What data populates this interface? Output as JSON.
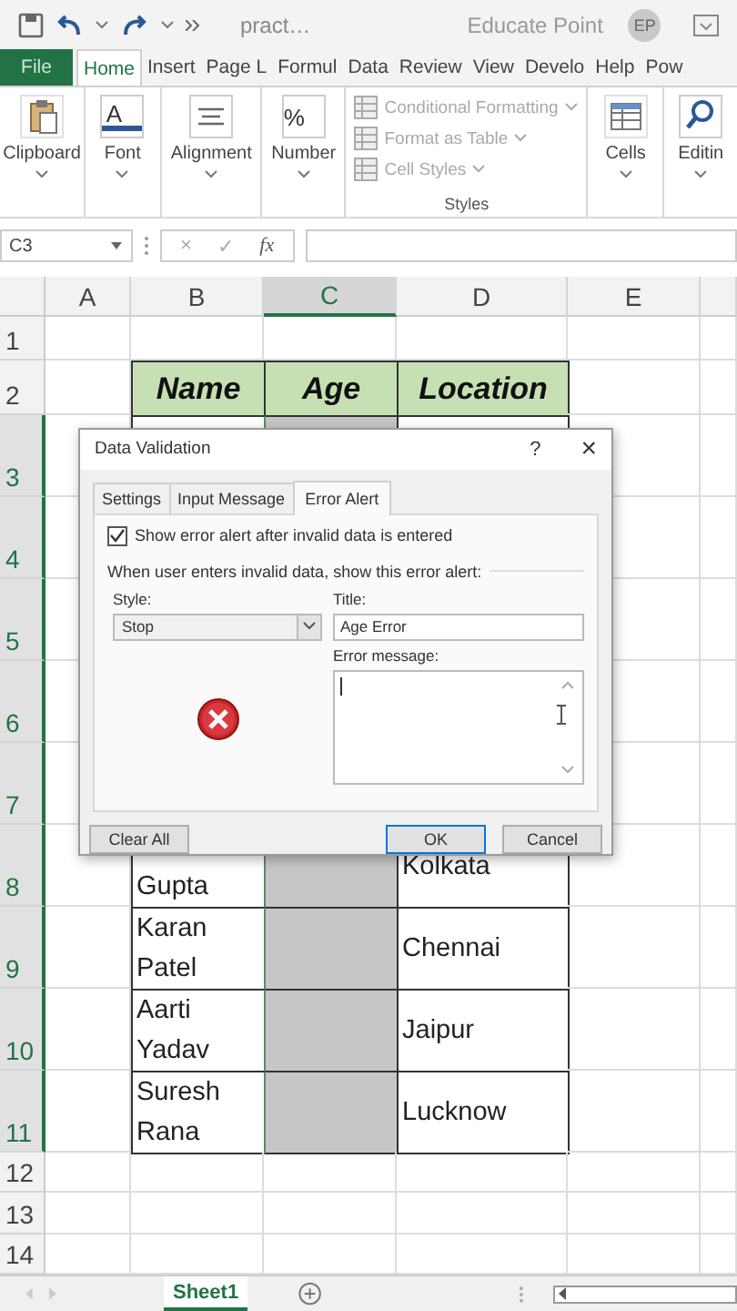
{
  "title_bar": {
    "document": "pract…",
    "account": "Educate Point",
    "initials": "EP"
  },
  "ribbon_tabs": [
    {
      "label": "File",
      "kind": "file",
      "selected": false
    },
    {
      "label": "Home",
      "kind": "tab",
      "selected": true
    },
    {
      "label": "Insert",
      "kind": "tab",
      "selected": false
    },
    {
      "label": "Page L",
      "kind": "tab",
      "selected": false
    },
    {
      "label": "Formul",
      "kind": "tab",
      "selected": false
    },
    {
      "label": "Data",
      "kind": "tab",
      "selected": false
    },
    {
      "label": "Review",
      "kind": "tab",
      "selected": false
    },
    {
      "label": "View",
      "kind": "tab",
      "selected": false
    },
    {
      "label": "Develo",
      "kind": "tab",
      "selected": false
    },
    {
      "label": "Help",
      "kind": "tab",
      "selected": false
    },
    {
      "label": "Pow",
      "kind": "tab",
      "selected": false
    }
  ],
  "ribbon_groups": [
    {
      "kind": "clipboard",
      "label": "Clipboard"
    },
    {
      "kind": "font",
      "glyph": "A",
      "label": "Font"
    },
    {
      "kind": "alignment",
      "label": "Alignment"
    },
    {
      "kind": "number",
      "glyph": "%",
      "label": "Number"
    },
    {
      "kind": "styles",
      "label": "Styles",
      "items": [
        {
          "label": "Conditional Formatting",
          "disabled": true
        },
        {
          "label": "Format as Table",
          "disabled": true
        },
        {
          "label": "Cell Styles",
          "disabled": true
        }
      ]
    },
    {
      "kind": "cells",
      "label": "Cells"
    },
    {
      "kind": "editing",
      "label": "Editin"
    }
  ],
  "formula_bar": {
    "name_box": "C3",
    "cancel": "×",
    "enter": "✓",
    "function": "fx"
  },
  "columns": [
    {
      "label": "A",
      "selected": false
    },
    {
      "label": "B",
      "selected": false
    },
    {
      "label": "C",
      "selected": true
    },
    {
      "label": "D",
      "selected": false
    },
    {
      "label": "E",
      "selected": false
    }
  ],
  "rows": [
    {
      "number": "1",
      "kind": "blank",
      "selected": false
    },
    {
      "number": "2",
      "kind": "header",
      "selected": false,
      "cells": [
        "Name",
        "Age",
        "Location"
      ]
    },
    {
      "number": "3",
      "kind": "data",
      "selected": true
    },
    {
      "number": "4",
      "kind": "data",
      "selected": true
    },
    {
      "number": "5",
      "kind": "data",
      "selected": true
    },
    {
      "number": "6",
      "kind": "data",
      "selected": true
    },
    {
      "number": "7",
      "kind": "data",
      "selected": true
    },
    {
      "number": "8",
      "kind": "data",
      "selected": true,
      "name": "Gupta",
      "location": "Kolkata"
    },
    {
      "number": "9",
      "kind": "data",
      "selected": true,
      "name": "Karan Patel",
      "location": "Chennai"
    },
    {
      "number": "10",
      "kind": "data",
      "selected": true,
      "name": "Aarti Yadav",
      "location": "Jaipur"
    },
    {
      "number": "11",
      "kind": "data",
      "selected": true,
      "name": "Suresh Rana",
      "location": "Lucknow"
    },
    {
      "number": "12",
      "kind": "blank",
      "selected": false
    },
    {
      "number": "13",
      "kind": "blank",
      "selected": false
    },
    {
      "number": "14",
      "kind": "blank",
      "selected": false
    }
  ],
  "dialog": {
    "title": "Data Validation",
    "help": "?",
    "close": "×",
    "tabs": [
      {
        "label": "Settings",
        "selected": false
      },
      {
        "label": "Input Message",
        "selected": false
      },
      {
        "label": "Error Alert",
        "selected": true
      }
    ],
    "show_alert": {
      "label": "Show error alert after invalid data is entered",
      "checked": true
    },
    "section": "When user enters invalid data, show this error alert:",
    "style": {
      "label": "Style:",
      "value": "Stop"
    },
    "title_field": {
      "label": "Title:",
      "value": "Age Error"
    },
    "message_field": {
      "label": "Error message:"
    },
    "buttons": [
      {
        "label": "Clear All",
        "kind": "secondary"
      },
      {
        "label": "OK",
        "kind": "default"
      },
      {
        "label": "Cancel",
        "kind": "secondary"
      }
    ]
  },
  "sheet_tabs": [
    {
      "label": "Sheet1",
      "selected": true
    }
  ]
}
